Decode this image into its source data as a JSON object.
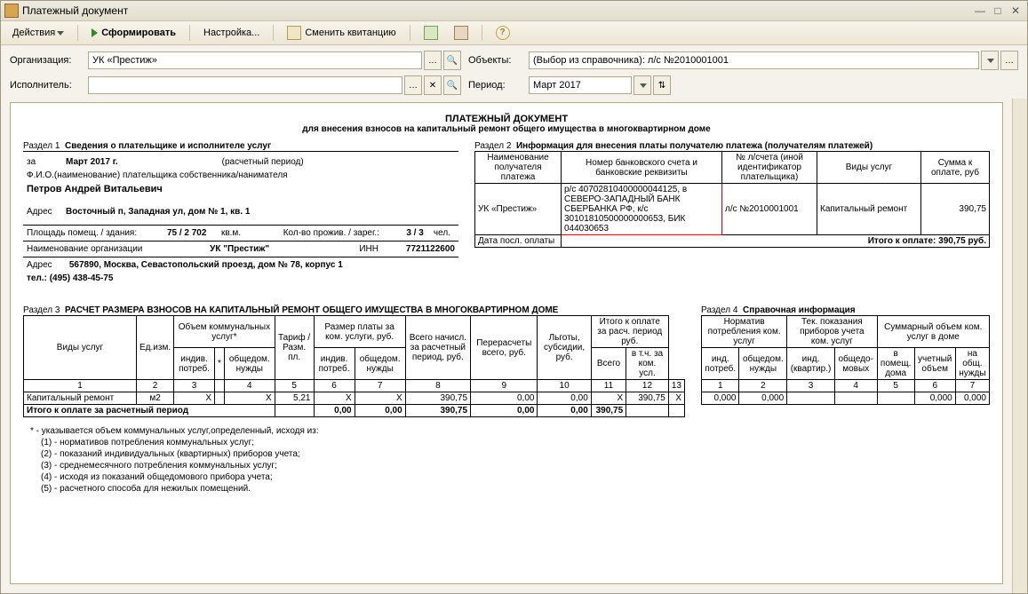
{
  "window": {
    "title": "Платежный документ"
  },
  "toolbar": {
    "actions": "Действия",
    "generate": "Сформировать",
    "settings": "Настройка...",
    "changeReceipt": "Сменить квитанцию"
  },
  "form": {
    "orgLabel": "Организация:",
    "orgValue": "УК «Престиж»",
    "objectsLabel": "Объекты:",
    "objectsValue": "(Выбор из справочника): л/с №2010001001",
    "execLabel": "Исполнитель:",
    "periodLabel": "Период:",
    "periodValue": "Март 2017"
  },
  "doc": {
    "title": "ПЛАТЕЖНЫЙ ДОКУМЕНТ",
    "subtitle": "для внесения взносов на капитальный ремонт общего имущества в многоквартирном доме",
    "s1": {
      "num": "Раздел 1",
      "title": "Сведения о плательщике и исполнителе услуг",
      "zaLabel": "за",
      "period": "Март 2017 г.",
      "periodNote": "(расчетный период)",
      "fioLabel": "Ф.И.О.(наименование) плательщика собственника/нанимателя",
      "fio": "Петров Андрей Витальевич",
      "addrLabel": "Адрес",
      "addr": "Восточный п, Западная ул, дом № 1, кв. 1",
      "areaLabel": "Площадь помещ. / здания:",
      "area": "75 / 2 702",
      "areaUnit": "кв.м.",
      "livLabel": "Кол-во прожив. / зарег.:",
      "liv": "3 / 3",
      "livUnit": "чел.",
      "orgLabel": "Наименование организации",
      "org": "УК \"Престиж\"",
      "innLabel": "ИНН",
      "inn": "7721122600",
      "addr2Label": "Адрес",
      "addr2": "567890, Москва, Севастопольский проезд, дом № 78, корпус 1",
      "tel": "тел.: (495) 438-45-75"
    },
    "s2": {
      "num": "Раздел 2",
      "title": "Информация для внесения платы получателю платежа (получателям платежей)",
      "h": [
        "Наименование получателя платежа",
        "Номер банковского счета и банковские реквизиты",
        "№ л/счета (иной идентификатор плательщика)",
        "Виды услуг",
        "Сумма к оплате, руб"
      ],
      "row": [
        "УК «Престиж»",
        "р/с 40702810400000044125, в СЕВЕРО-ЗАПАДНЫЙ БАНК СБЕРБАНКА РФ, к/с 30101810500000000653, БИК 044030653",
        "л/с №2010001001",
        "Капитальный ремонт",
        "390,75"
      ],
      "lastPayLabel": "Дата посл. оплаты",
      "total": "Итого к оплате: 390,75 руб."
    },
    "s3": {
      "num": "Раздел 3",
      "title": "РАСЧЕТ РАЗМЕРА ВЗНОСОВ НА КАПИТАЛЬНЫЙ РЕМОНТ ОБЩЕГО ИМУЩЕСТВА В МНОГОКВАРТИРНОМ ДОМЕ",
      "h1": [
        "Виды услуг",
        "Ед.изм.",
        "Объем коммунальных услуг*",
        "Тариф / Разм. пл.",
        "Размер платы за ком. услуги, руб.",
        "Всего начисл. за расчетный период, руб.",
        "Перерасчеты всего, руб.",
        "Льготы, субсидии, руб.",
        "Итого к оплате за расч. период руб."
      ],
      "h2": [
        "индив. потреб.",
        "*",
        "общедом. нужды",
        "индив. потреб.",
        "общедом. нужды",
        "Всего",
        "в т.ч. за ком. усл."
      ],
      "row": [
        "Капитальный ремонт",
        "м2",
        "X",
        "X",
        "5,21",
        "X",
        "X",
        "390,75",
        "0,00",
        "0,00",
        "X",
        "390,75",
        "X"
      ],
      "totalLabel": "Итого к оплате за расчетный период",
      "tot": [
        "0,00",
        "0,00",
        "390,75",
        "0,00",
        "0,00",
        "390,75"
      ]
    },
    "s4": {
      "num": "Раздел 4",
      "title": "Справочная информация",
      "h1": [
        "Норматив потребления ком. услуг",
        "Тек. показания приборов учета ком. услуг",
        "Суммарный объем ком. услуг в доме"
      ],
      "h2": [
        "инд. потреб.",
        "общедом. нужды",
        "инд. (квартир.)",
        "общедо-мовых",
        "в помещ. дома",
        "учетный объем",
        "на общ. нужды"
      ],
      "row": [
        "0,000",
        "0,000",
        "",
        "",
        "",
        "0,000",
        "0,000"
      ]
    },
    "foot": [
      "* - указывается объем коммунальных услуг,определенный, исходя из:",
      "(1) - нормативов потребления коммунальных услуг;",
      "(2) - показаний индивидуальных (квартирных) приборов учета;",
      "(3) - среднемесячного потребления коммунальных услуг;",
      "(4) - исходя из показаний общедомового прибора учета;",
      "(5) - расчетного способа для нежилых помещений."
    ]
  }
}
